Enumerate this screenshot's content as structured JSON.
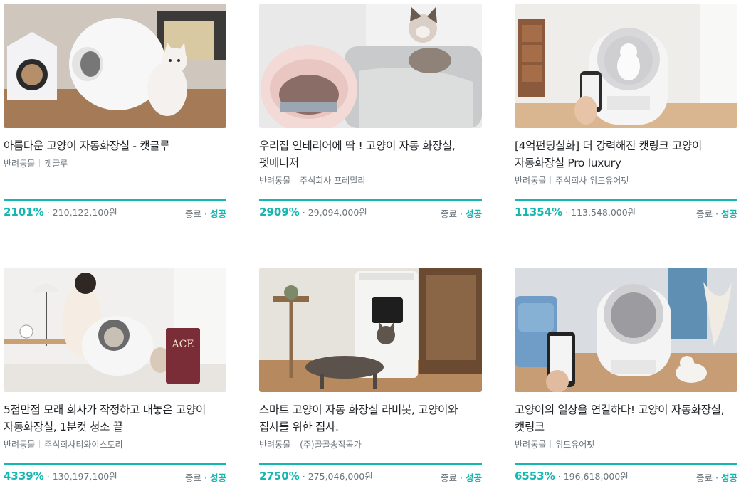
{
  "colors": {
    "accent": "#16b6b1",
    "muted": "#6c757d",
    "text": "#212529"
  },
  "projects": [
    {
      "title": "아름다운 고양이 자동화장실 - 캣글루",
      "category": "반려동물",
      "maker": "캣글루",
      "percent": "2101%",
      "amount": "· 210,122,100원",
      "status_label": "종료 ·",
      "status_result": "성공",
      "image_icon": "cat-litter-box-photo"
    },
    {
      "title": "우리집 인테리어에 딱 ! 고양이 자동 화장실, 펫매니저",
      "category": "반려동물",
      "maker": "주식회사 프레밀리",
      "percent": "2909%",
      "amount": "· 29,094,000원",
      "status_label": "종료 ·",
      "status_result": "성공",
      "image_icon": "cat-litter-box-photo"
    },
    {
      "title": "[4억펀딩실화] 더 강력해진 캣링크 고양이 자동화장실 Pro luxury",
      "category": "반려동물",
      "maker": "주식회사 위드유어펫",
      "percent": "11354%",
      "amount": "· 113,548,000원",
      "status_label": "종료 ·",
      "status_result": "성공",
      "image_icon": "cat-litter-box-photo"
    },
    {
      "title": "5점만점 모래 회사가 작정하고 내놓은 고양이 자동화장실, 1분컷 청소 끝",
      "category": "반려동물",
      "maker": "주식회사티와이스토리",
      "percent": "4339%",
      "amount": "· 130,197,100원",
      "status_label": "종료 ·",
      "status_result": "성공",
      "image_icon": "cat-litter-box-photo"
    },
    {
      "title": "스마트 고양이 자동 화장실 라비봇, 고양이와 집사를 위한 집사.",
      "category": "반려동물",
      "maker": "(주)골골송작곡가",
      "percent": "2750%",
      "amount": "· 275,046,000원",
      "status_label": "종료 ·",
      "status_result": "성공",
      "image_icon": "cat-litter-box-photo"
    },
    {
      "title": "고양이의 일상을 연결하다! 고양이 자동화장실, 캣링크",
      "category": "반려동물",
      "maker": "위드유어펫",
      "percent": "6553%",
      "amount": "· 196,618,000원",
      "status_label": "종료 ·",
      "status_result": "성공",
      "image_icon": "cat-litter-box-photo"
    }
  ]
}
